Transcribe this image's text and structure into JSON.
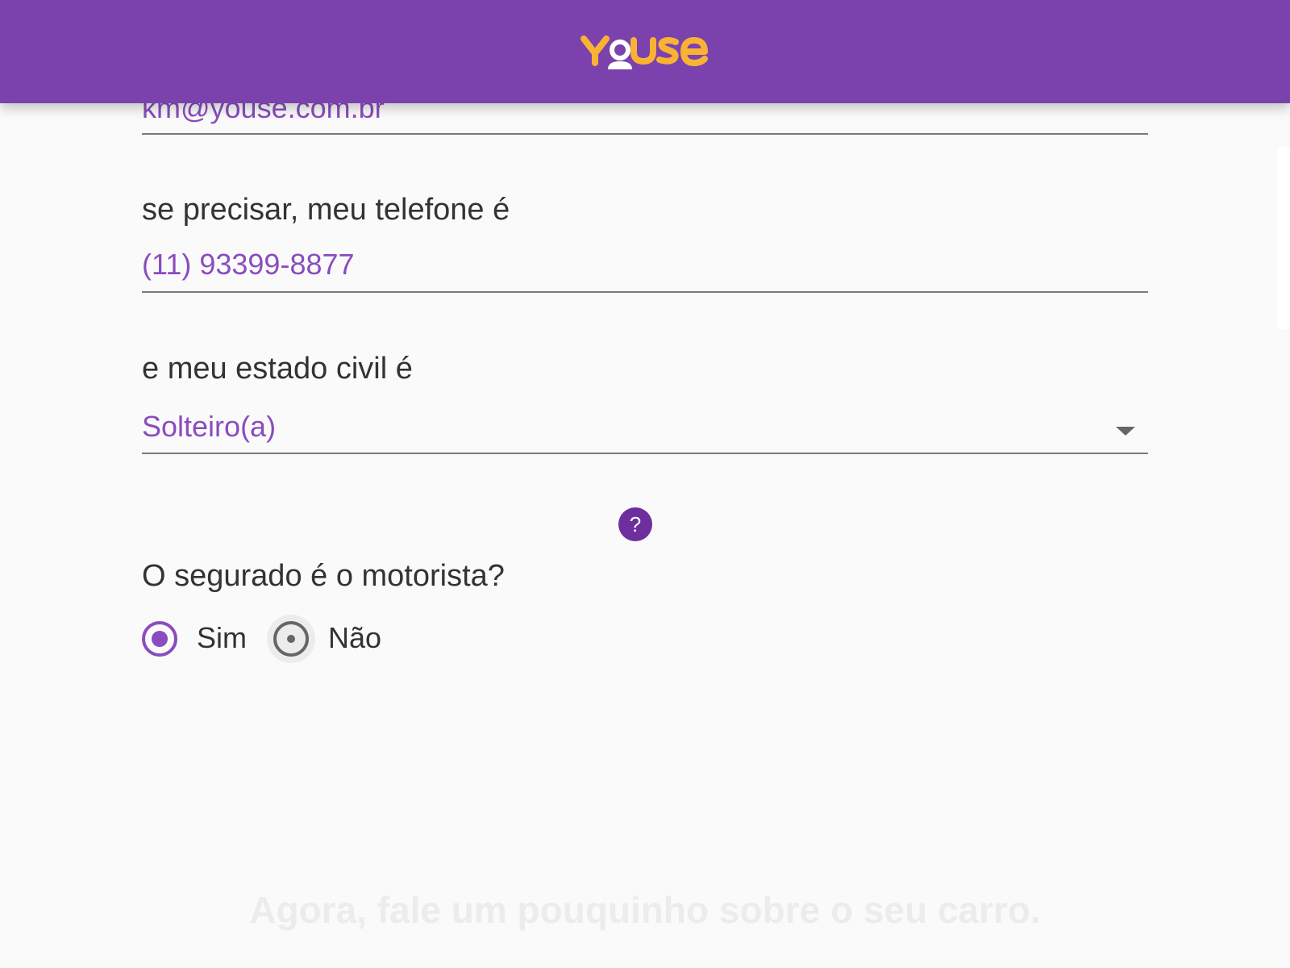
{
  "header": {
    "logo_text": "youse",
    "background_color": "#7b42ad",
    "logo_color": "#f9b233"
  },
  "form": {
    "email": {
      "value": "km@youse.com.br"
    },
    "phone": {
      "label": "se precisar, meu telefone é",
      "value": "(11) 93399-8877"
    },
    "civil_status": {
      "label": "e meu estado civil é",
      "selected": "Solteiro(a)"
    },
    "help_icon": "?",
    "driver": {
      "question": "O segurado é o motorista?",
      "options": [
        {
          "label": "Sim",
          "selected": true
        },
        {
          "label": "Não",
          "selected": false
        }
      ]
    }
  },
  "next_section": {
    "heading": "Agora, fale um pouquinho sobre o seu carro."
  },
  "colors": {
    "accent": "#8a4cbf",
    "help_icon": "#6d2e9e",
    "text": "#333333"
  }
}
